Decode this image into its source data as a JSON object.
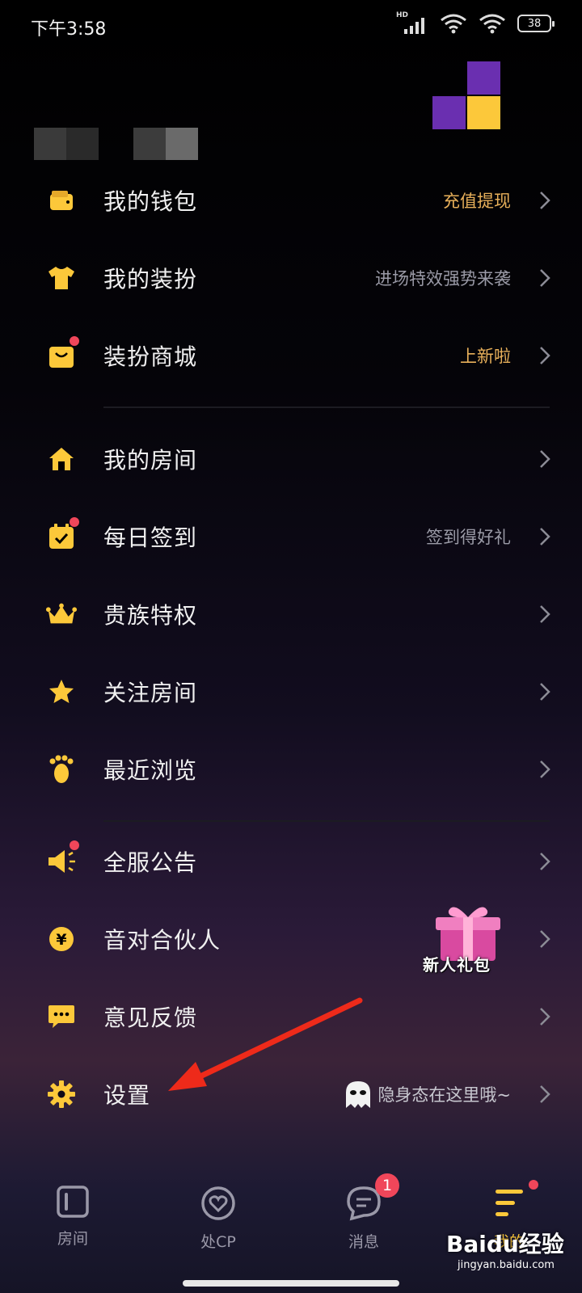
{
  "status_bar": {
    "time": "下午3:58",
    "battery": "38"
  },
  "menu": {
    "items": [
      {
        "label": "我的钱包",
        "right": "充值提现",
        "right_color": "#e8b05a",
        "icon": "wallet-icon",
        "dot": false
      },
      {
        "label": "我的装扮",
        "right": "进场特效强势来袭",
        "right_color": "#9a9aa6",
        "icon": "tshirt-icon",
        "dot": false
      },
      {
        "label": "装扮商城",
        "right": "上新啦",
        "right_color": "#e8b05a",
        "icon": "shopping-bag-icon",
        "dot": true
      },
      {
        "label": "我的房间",
        "right": "",
        "icon": "house-icon",
        "dot": false
      },
      {
        "label": "每日签到",
        "right": "签到得好礼",
        "right_color": "#9a9aa6",
        "icon": "calendar-check-icon",
        "dot": true
      },
      {
        "label": "贵族特权",
        "right": "",
        "icon": "crown-icon",
        "dot": false
      },
      {
        "label": "关注房间",
        "right": "",
        "icon": "star-icon",
        "dot": false
      },
      {
        "label": "最近浏览",
        "right": "",
        "icon": "footprint-icon",
        "dot": false
      },
      {
        "label": "全服公告",
        "right": "",
        "icon": "megaphone-icon",
        "dot": true
      },
      {
        "label": "音对合伙人",
        "right": "",
        "icon": "yen-coin-icon",
        "dot": false
      },
      {
        "label": "意见反馈",
        "right": "",
        "icon": "chat-bubble-icon",
        "dot": false
      },
      {
        "label": "设置",
        "right": "隐身态在这里哦~",
        "right_color": "#c8c8d0",
        "icon": "gear-icon",
        "dot": false
      }
    ]
  },
  "gift": {
    "label": "新人礼包"
  },
  "tabbar": {
    "tabs": [
      {
        "label": "房间",
        "icon": "room-icon"
      },
      {
        "label": "处CP",
        "icon": "heart-ring-icon"
      },
      {
        "label": "消息",
        "icon": "message-icon",
        "badge": "1"
      },
      {
        "label": "我的",
        "icon": "menu-lines-icon"
      }
    ]
  },
  "watermark": {
    "main": "Baidu经验",
    "sub": "jingyan.baidu.com"
  },
  "colors": {
    "accent": "#fcc83a",
    "badge": "#f0465a"
  }
}
